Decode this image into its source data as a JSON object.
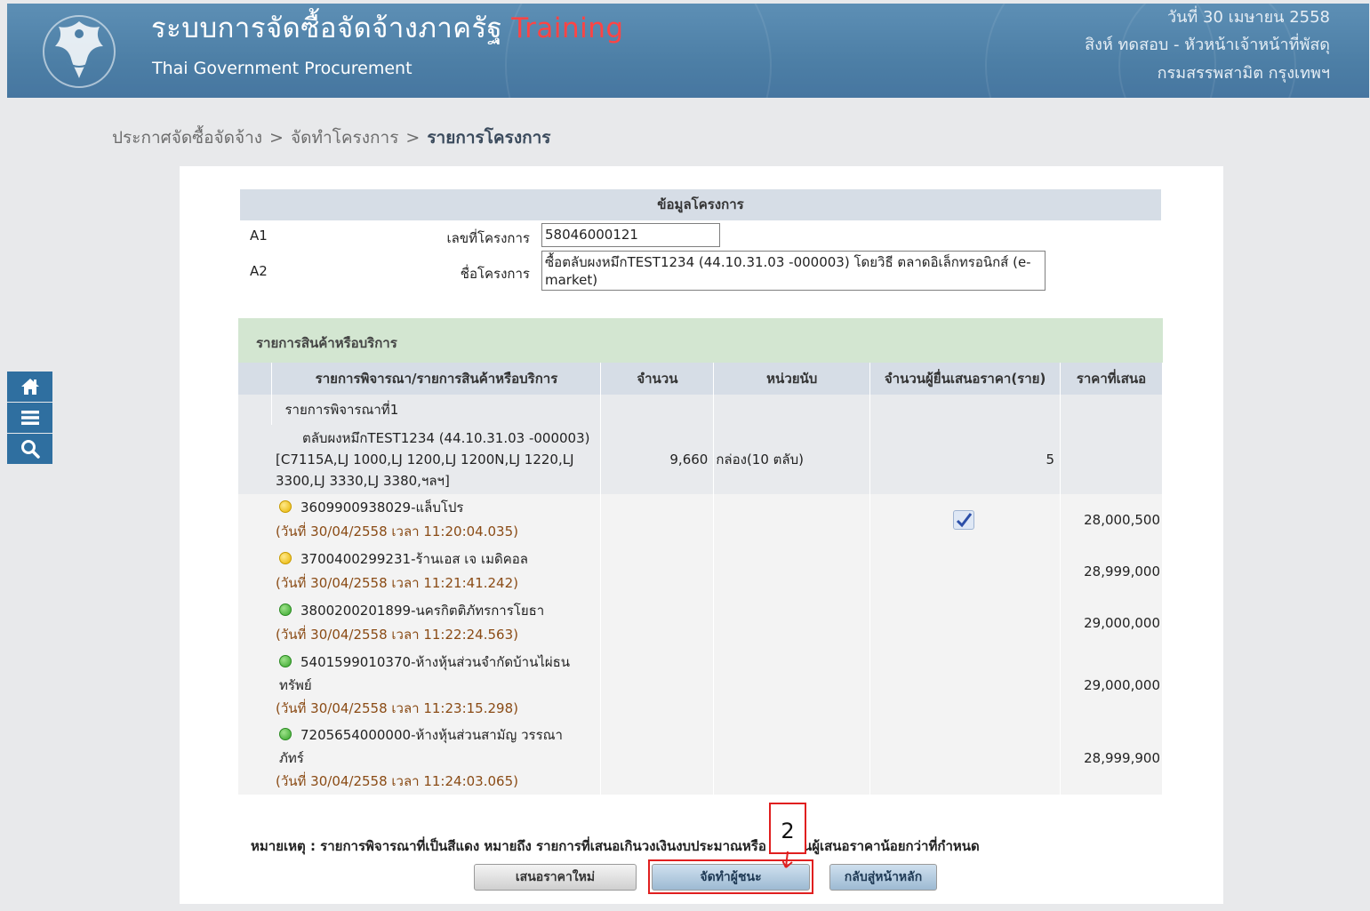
{
  "header": {
    "title": "ระบบการจัดซื้อจัดจ้างภาครัฐ",
    "title_suffix": "Training",
    "subtitle": "Thai Government Procurement",
    "date": "วันที่ 30 เมษายน 2558",
    "user": "สิงห์ ทดสอบ - หัวหน้าเจ้าหน้าที่พัสดุ",
    "department": "กรมสรรพสามิต กรุงเทพฯ"
  },
  "breadcrumb": [
    "ประกาศจัดซื้อจัดจ้าง",
    "จัดทำโครงการ",
    "รายการโครงการ"
  ],
  "breadcrumb_separator": ">",
  "sidenav": [
    "home-icon",
    "menu-icon",
    "search-icon"
  ],
  "project_info": {
    "section_title": "ข้อมูลโครงการ",
    "rows": [
      {
        "code": "A1",
        "label": "เลขที่โครงการ",
        "value": "58046000121"
      },
      {
        "code": "A2",
        "label": "ชื่อโครงการ",
        "value": "ซื้อตลับผงหมึกTEST1234 (44.10.31.03 -000003) โดยวิธี ตลาดอิเล็กทรอนิกส์ (e-market)"
      }
    ]
  },
  "items": {
    "section_title": "รายการสินค้าหรือบริการ",
    "columns": [
      "รายการพิจารณา/รายการสินค้าหรือบริการ",
      "จำนวน",
      "หน่วยนับ",
      "จำนวนผู้ยื่นเสนอราคา(ราย)",
      "ราคาที่เสนอ"
    ],
    "group_label": "รายการพิจารณาที่1",
    "item": {
      "description": "ตลับผงหมึกTEST1234 (44.10.31.03 -000003)[C7115A,LJ 1000,LJ 1200,LJ 1200N,LJ 1220,LJ 3300,LJ 3330,LJ 3380,ฯลฯ]",
      "quantity": "9,660",
      "unit": "กล่อง(10 ตลับ)",
      "bidder_count": "5"
    },
    "bids": [
      {
        "vendor": "3609900938029-แล็บโปร",
        "timestamp": "(วันที่ 30/04/2558 เวลา 11:20:04.035)",
        "price": "28,000,500",
        "status": "yellow",
        "selected": true
      },
      {
        "vendor": "3700400299231-ร้านเอส เจ เมดิคอล",
        "timestamp": "(วันที่ 30/04/2558 เวลา 11:21:41.242)",
        "price": "28,999,000",
        "status": "yellow",
        "selected": false
      },
      {
        "vendor": "3800200201899-นครกิตติภัทรการโยธา",
        "timestamp": "(วันที่ 30/04/2558 เวลา 11:22:24.563)",
        "price": "29,000,000",
        "status": "green",
        "selected": false
      },
      {
        "vendor": "5401599010370-ห้างหุ้นส่วนจำกัดบ้านไผ่ธนทรัพย์",
        "timestamp": "(วันที่ 30/04/2558 เวลา 11:23:15.298)",
        "price": "29,000,000",
        "status": "green",
        "selected": false
      },
      {
        "vendor": "7205654000000-ห้างหุ้นส่วนสามัญ วรรณาภัทร์",
        "timestamp": "(วันที่ 30/04/2558 เวลา 11:24:03.065)",
        "price": "28,999,900",
        "status": "green",
        "selected": false
      }
    ]
  },
  "remark": "หมายเหตุ : รายการพิจารณาที่เป็นสีแดง หมายถึง รายการที่เสนอเกินวงเงินงบประมาณหรือ จำนวนผู้เสนอราคาน้อยกว่าที่กำหนด",
  "buttons": {
    "new_bid": "เสนอราคาใหม่",
    "make_winner": "จัดทำผู้ชนะ",
    "back_home": "กลับสู่หน้าหลัก"
  },
  "callout_number": "2",
  "colors": {
    "header_bg": "#4d7fa6",
    "training": "#ff4444",
    "callout": "#e01f1f",
    "timestamp": "#8a4b15"
  }
}
